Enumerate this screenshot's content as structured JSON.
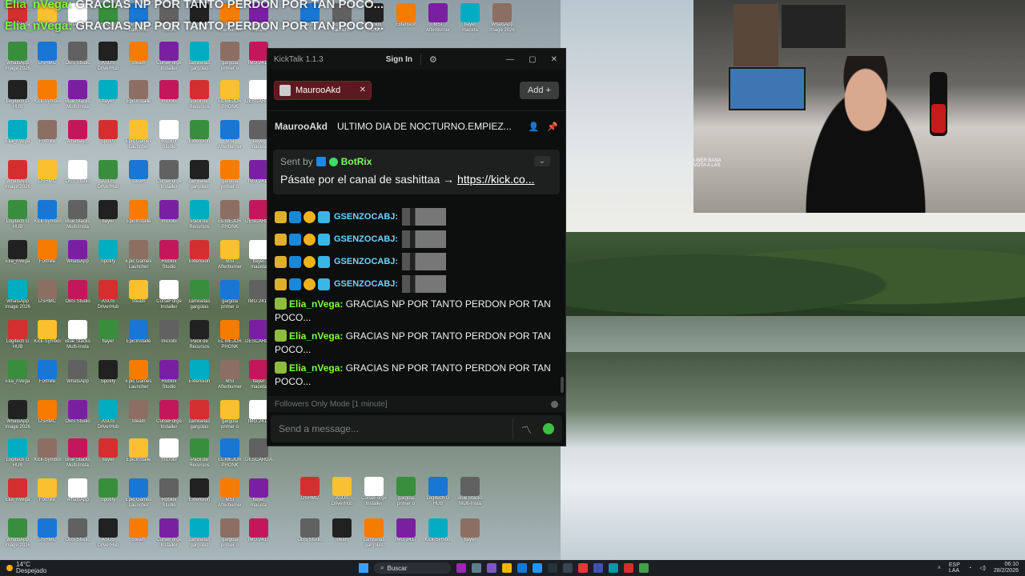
{
  "overlay": {
    "line1_user": "Elia_nVega:",
    "line1_text": " GRACIAS NP POR TANTO PERDON POR TAN POCO...",
    "line2_user": "Elia_nVega:",
    "line2_text": " GRACIAS NP POR TANTO PERDON POR TAN POCO..."
  },
  "kicktalk": {
    "app_title": "KickTalk 1.1.3",
    "sign_in": "Sign In",
    "tab_label": "MaurooAkd",
    "add_label": "Add",
    "channel_name": "MaurooAkd",
    "stream_title": "ULTIMO DIA DE NOCTURNO.EMPIEZ...",
    "pinned": {
      "sent_by": "Sent by",
      "bot_name": "BotRix",
      "message": "Pásate por el canal de sashittaa → ",
      "link": "https://kick.co..."
    },
    "chat_lines": [
      {
        "user": "GSENZOCABJ:"
      },
      {
        "user": "GSENZOCABJ:"
      },
      {
        "user": "GSENZOCABJ:"
      },
      {
        "user": "GSENZOCABJ:"
      }
    ],
    "messages": [
      {
        "user": "Elia_nVega:",
        "text": " GRACIAS NP POR TANTO PERDON POR TAN POCO..."
      },
      {
        "user": "Elia_nVega:",
        "text": " GRACIAS NP POR TANTO PERDON POR TAN POCO..."
      },
      {
        "user": "Elia_nVega:",
        "text": " GRACIAS NP POR TANTO PERDON POR TAN POCO..."
      }
    ],
    "followers_mode": "Followers Only Mode [1 minute]",
    "input_placeholder": "Send a message..."
  },
  "webcam": {
    "side_chat_line1": "UBER BANA",
    "side_chat_line2": "VOTA A LAS"
  },
  "taskbar": {
    "temperature": "14°C",
    "weather": "Despejado",
    "search": "Buscar",
    "language": "ESP",
    "region": "LAA",
    "time": "06:10",
    "date": "28/2/2026"
  },
  "desktop_icons": [
    "Elia_nVega",
    "Fortnite",
    "WhatsApp",
    "Spotify",
    "Epic Games Launcher",
    "Roblox Studio",
    "Extension",
    "MSI Afterburner",
    "flayer maceta",
    "WhatsApp Image 2026",
    "DSHMC",
    "OBS Studio",
    "ASUS DriverHub",
    "Steam",
    "CurseForge Installer",
    "camisetas gargolas",
    "gargola primer o",
    "IMG 2417",
    "Logitech G HUB",
    "Kick-Symbol",
    "Blue Stacks Multi-Insta",
    "flayer",
    "EpicInstalle",
    "microbi",
    "Pack de Recursos",
    "EL MEJOR PHONK",
    "DESCARGA"
  ]
}
